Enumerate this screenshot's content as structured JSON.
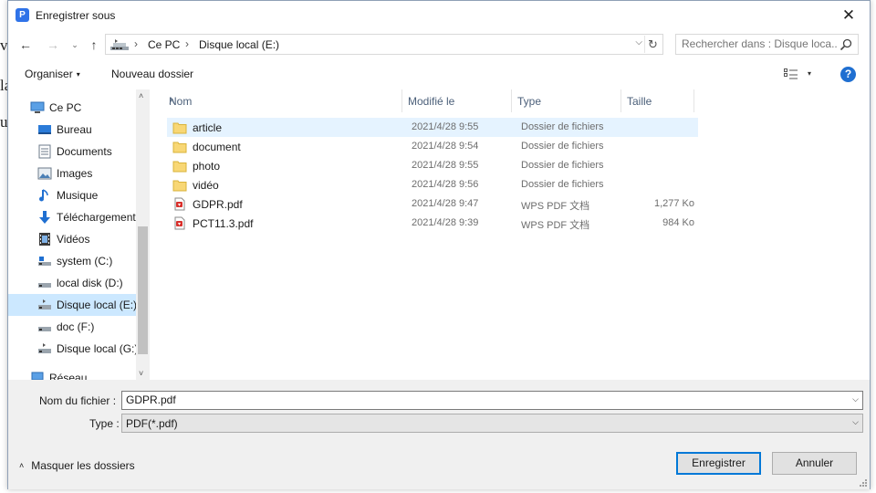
{
  "backdrop": {
    "fragments": [
      "v",
      "la",
      "u"
    ]
  },
  "window": {
    "title": "Enregistrer sous",
    "app_icon_letter": "P",
    "close_glyph": "✕"
  },
  "address": {
    "back_glyph": "←",
    "forward_glyph": "→",
    "recent_glyph": "⌄",
    "up_glyph": "↑",
    "crumbs": [
      "Ce PC",
      "Disque local (E:)"
    ],
    "separator": "›",
    "dropdown_glyph": "⌵",
    "refresh_glyph": "↻",
    "icon": "computer-icon"
  },
  "search": {
    "placeholder": "Rechercher dans : Disque loca...",
    "icon": "search-icon"
  },
  "toolbar": {
    "organize_label": "Organiser",
    "new_folder_label": "Nouveau dossier",
    "caret": "▾",
    "view_icon": "view-details-icon",
    "help_label": "?"
  },
  "sidebar": {
    "items": [
      {
        "label": "Ce PC",
        "icon": "computer-icon"
      },
      {
        "label": "Bureau",
        "icon": "desktop-icon"
      },
      {
        "label": "Documents",
        "icon": "documents-icon"
      },
      {
        "label": "Images",
        "icon": "pictures-icon"
      },
      {
        "label": "Musique",
        "icon": "music-icon"
      },
      {
        "label": "Téléchargement",
        "icon": "download-icon"
      },
      {
        "label": "Vidéos",
        "icon": "videos-icon"
      },
      {
        "label": "system (C:)",
        "icon": "drive-icon"
      },
      {
        "label": "local disk (D:)",
        "icon": "drive-icon"
      },
      {
        "label": "Disque local (E:)",
        "icon": "drive-icon",
        "selected": true
      },
      {
        "label": "doc (F:)",
        "icon": "drive-icon"
      },
      {
        "label": "Disque local (G:)",
        "icon": "drive-icon"
      },
      {
        "label": "Réseau",
        "icon": "network-icon"
      }
    ],
    "scroll_up": "˄",
    "scroll_down": "˅"
  },
  "columns": {
    "name": "Nom",
    "modified": "Modifié le",
    "type": "Type",
    "size": "Taille",
    "sort_glyph": "˄"
  },
  "files": [
    {
      "name": "article",
      "modified": "2021/4/28 9:55",
      "type": "Dossier de fichiers",
      "size": "",
      "icon": "folder-icon",
      "hover": true
    },
    {
      "name": "document",
      "modified": "2021/4/28 9:54",
      "type": "Dossier de fichiers",
      "size": "",
      "icon": "folder-icon"
    },
    {
      "name": "photo",
      "modified": "2021/4/28 9:55",
      "type": "Dossier de fichiers",
      "size": "",
      "icon": "folder-icon"
    },
    {
      "name": "vidéo",
      "modified": "2021/4/28 9:56",
      "type": "Dossier de fichiers",
      "size": "",
      "icon": "folder-icon"
    },
    {
      "name": "GDPR.pdf",
      "modified": "2021/4/28 9:47",
      "type": "WPS PDF 文档",
      "size": "1,277 Ko",
      "icon": "pdf-file-icon"
    },
    {
      "name": "PCT11.3.pdf",
      "modified": "2021/4/28 9:39",
      "type": "WPS PDF 文档",
      "size": "984 Ko",
      "icon": "pdf-file-icon"
    }
  ],
  "form": {
    "filename_label": "Nom du fichier :",
    "filename_value": "GDPR.pdf",
    "type_label": "Type :",
    "type_value": "PDF(*.pdf)",
    "dropdown_glyph": "⌵"
  },
  "footer": {
    "hide_folders_label": "Masquer les dossiers",
    "hide_folders_glyph": "˄",
    "save_label": "Enregistrer",
    "cancel_label": "Annuler"
  },
  "colors": {
    "accent": "#0078d7",
    "selection": "#cce8ff",
    "hover": "#e5f3ff",
    "folder": "#f8d775",
    "pdf": "#d9302c",
    "header_text": "#4c607a"
  }
}
